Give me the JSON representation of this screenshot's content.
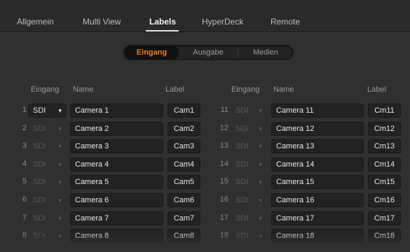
{
  "tabs": [
    {
      "label": "Allgemein",
      "active": false
    },
    {
      "label": "Multi View",
      "active": false
    },
    {
      "label": "Labels",
      "active": true
    },
    {
      "label": "HyperDeck",
      "active": false
    },
    {
      "label": "Remote",
      "active": false
    }
  ],
  "segments": [
    {
      "label": "Eingang",
      "active": true
    },
    {
      "label": "Ausgabe",
      "active": false
    },
    {
      "label": "Medien",
      "active": false
    }
  ],
  "columns": {
    "left": {
      "eingang": "Eingang",
      "name": "Name",
      "label": "Label"
    },
    "right": {
      "eingang": "Eingang",
      "name": "Name",
      "label": "Label"
    }
  },
  "colors": {
    "accent": "#f07b21"
  },
  "left_rows": [
    {
      "num": "1",
      "source": "SDI",
      "source_enabled": true,
      "name": "Camera 1",
      "label": "Cam1"
    },
    {
      "num": "2",
      "source": "SDI",
      "source_enabled": false,
      "name": "Camera 2",
      "label": "Cam2"
    },
    {
      "num": "3",
      "source": "SDI",
      "source_enabled": false,
      "name": "Camera 3",
      "label": "Cam3"
    },
    {
      "num": "4",
      "source": "SDI",
      "source_enabled": false,
      "name": "Camera 4",
      "label": "Cam4"
    },
    {
      "num": "5",
      "source": "SDI",
      "source_enabled": false,
      "name": "Camera 5",
      "label": "Cam5"
    },
    {
      "num": "6",
      "source": "SDI",
      "source_enabled": false,
      "name": "Camera 6",
      "label": "Cam6"
    },
    {
      "num": "7",
      "source": "SDI",
      "source_enabled": false,
      "name": "Camera 7",
      "label": "Cam7"
    },
    {
      "num": "8",
      "source": "SDI",
      "source_enabled": false,
      "name": "Camera 8",
      "label": "Cam8"
    }
  ],
  "right_rows": [
    {
      "num": "11",
      "source": "SDI",
      "source_enabled": false,
      "name": "Camera 11",
      "label": "Cm11"
    },
    {
      "num": "12",
      "source": "SDI",
      "source_enabled": false,
      "name": "Camera 12",
      "label": "Cm12"
    },
    {
      "num": "13",
      "source": "SDI",
      "source_enabled": false,
      "name": "Camera 13",
      "label": "Cm13"
    },
    {
      "num": "14",
      "source": "SDI",
      "source_enabled": false,
      "name": "Camera 14",
      "label": "Cm14"
    },
    {
      "num": "15",
      "source": "SDI",
      "source_enabled": false,
      "name": "Camera 15",
      "label": "Cm15"
    },
    {
      "num": "16",
      "source": "SDI",
      "source_enabled": false,
      "name": "Camera 16",
      "label": "Cm16"
    },
    {
      "num": "17",
      "source": "SDI",
      "source_enabled": false,
      "name": "Camera 17",
      "label": "Cm17"
    },
    {
      "num": "18",
      "source": "SDI",
      "source_enabled": false,
      "name": "Camera 18",
      "label": "Cm18"
    }
  ]
}
